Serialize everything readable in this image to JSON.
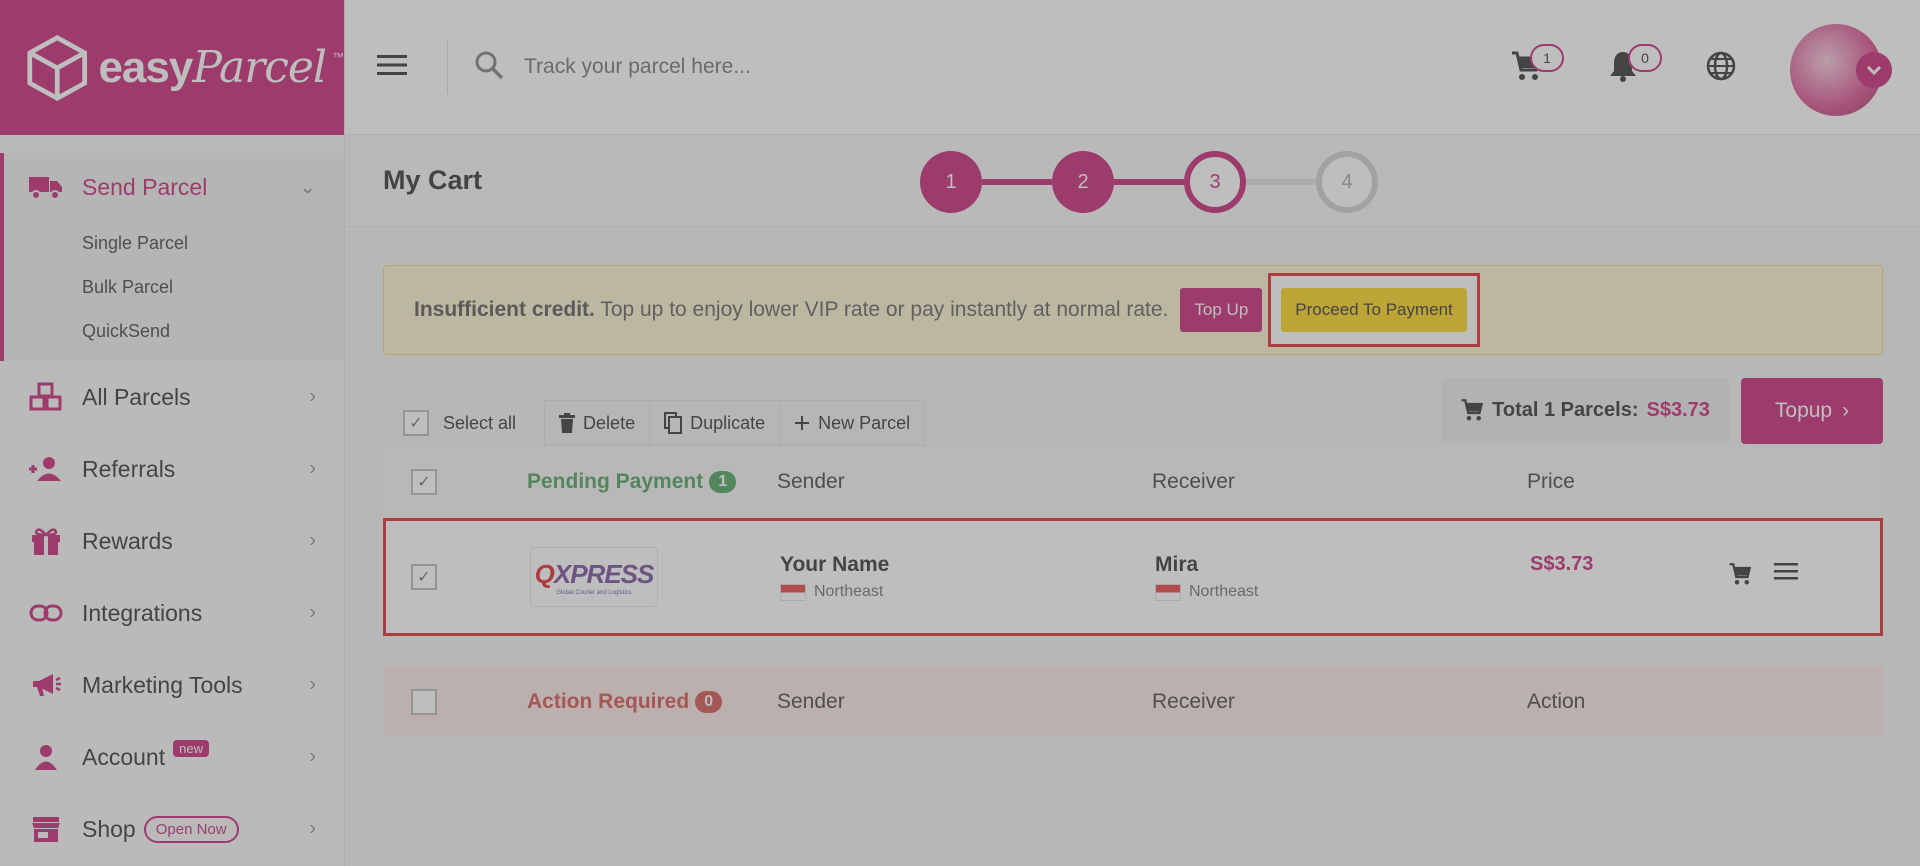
{
  "brand": {
    "name_part1": "easy",
    "name_part2": "Parcel",
    "tm": "™"
  },
  "search": {
    "placeholder": "Track your parcel here..."
  },
  "header": {
    "cart_count": "1",
    "notification_count": "0"
  },
  "sidebar": {
    "active": {
      "label": "Send Parcel",
      "sub_items": [
        "Single Parcel",
        "Bulk Parcel",
        "QuickSend"
      ]
    },
    "items": [
      {
        "label": "All Parcels"
      },
      {
        "label": "Referrals"
      },
      {
        "label": "Rewards"
      },
      {
        "label": "Integrations"
      },
      {
        "label": "Marketing Tools"
      },
      {
        "label": "Account",
        "badge": "new"
      },
      {
        "label": "Shop",
        "badge": "Open Now"
      }
    ]
  },
  "page": {
    "title": "My Cart"
  },
  "stepper": {
    "steps": [
      "1",
      "2",
      "3",
      "4"
    ],
    "current": 3
  },
  "alert": {
    "bold": "Insufficient credit.",
    "text": " Top up to enjoy lower VIP rate or pay instantly at normal rate.",
    "topup_label": "Top Up",
    "proceed_label": "Proceed To Payment"
  },
  "toolbar": {
    "select_all": "Select all",
    "delete": "Delete",
    "duplicate": "Duplicate",
    "new_parcel": "New Parcel"
  },
  "summary": {
    "label": "Total 1 Parcels:",
    "amount": "S$3.73",
    "topup_label": "Topup"
  },
  "pending": {
    "status": "Pending Payment",
    "count": "1",
    "headers": {
      "sender": "Sender",
      "receiver": "Receiver",
      "price": "Price"
    },
    "rows": [
      {
        "courier": "QXPRESS",
        "courier_first": "Q",
        "courier_rest": "XPRESS",
        "courier_sub": "Global Courier and Logistics",
        "sender_name": "Your Name",
        "sender_region": "Northeast",
        "receiver_name": "Mira",
        "receiver_region": "Northeast",
        "price": "S$3.73"
      }
    ]
  },
  "action_required": {
    "status": "Action Required",
    "count": "0",
    "headers": {
      "sender": "Sender",
      "receiver": "Receiver",
      "action": "Action"
    }
  },
  "colors": {
    "brand": "#c3126b",
    "proceed": "#fbcf0a",
    "highlight": "#e0151b",
    "success": "#3b9a4f",
    "danger": "#d0443e"
  }
}
